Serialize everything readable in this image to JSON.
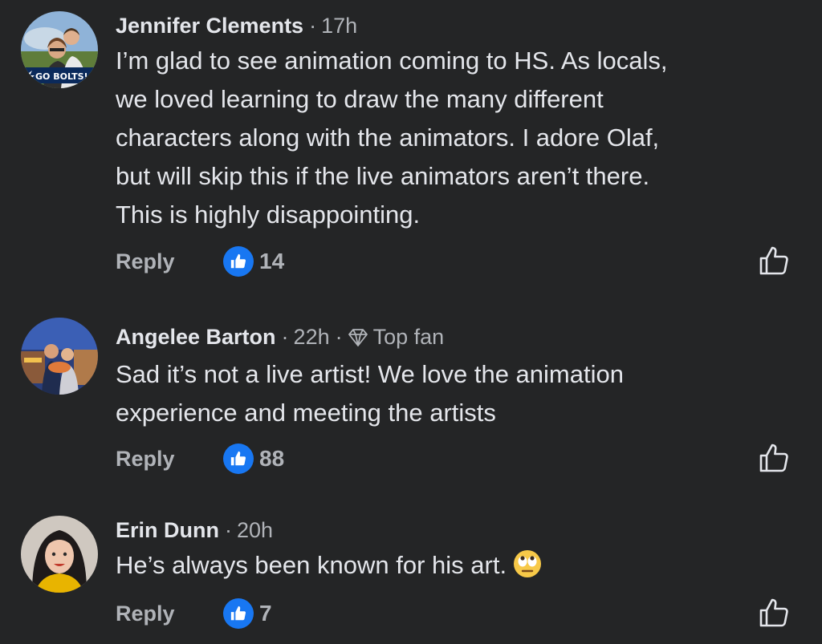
{
  "comments": [
    {
      "author": "Jennifer Clements",
      "time": "17h",
      "avatar_caption": "GO BOLTS!",
      "text_lines": [
        "I’m glad to see animation coming to HS. As locals,",
        "we loved learning to draw the many different",
        "characters along with the animators. I adore Olaf,",
        "but will skip this if the live animators aren’t there.",
        "This is highly disappointing."
      ],
      "reply_label": "Reply",
      "like_count": "14",
      "like_icon": "thumbs-up-outline-icon"
    },
    {
      "author": "Angelee Barton",
      "time": "22h",
      "badge": "Top fan",
      "badge_icon": "diamond-icon",
      "text_lines": [
        "Sad it’s not a live artist! We love the animation",
        "experience and meeting the artists"
      ],
      "reply_label": "Reply",
      "like_count": "88",
      "like_icon": "thumbs-up-outline-icon"
    },
    {
      "author": "Erin Dunn",
      "time": "20h",
      "text_lines": [
        "He’s always been known for his art."
      ],
      "text_emoji": "eye-roll-emoji",
      "reply_label": "Reply",
      "like_count": "7",
      "like_icon": "thumbs-up-outline-icon"
    }
  ],
  "colors": {
    "background": "#242526",
    "primary_text": "#e4e6eb",
    "secondary_text": "#b0b3b8",
    "like_blue": "#1877f2"
  }
}
